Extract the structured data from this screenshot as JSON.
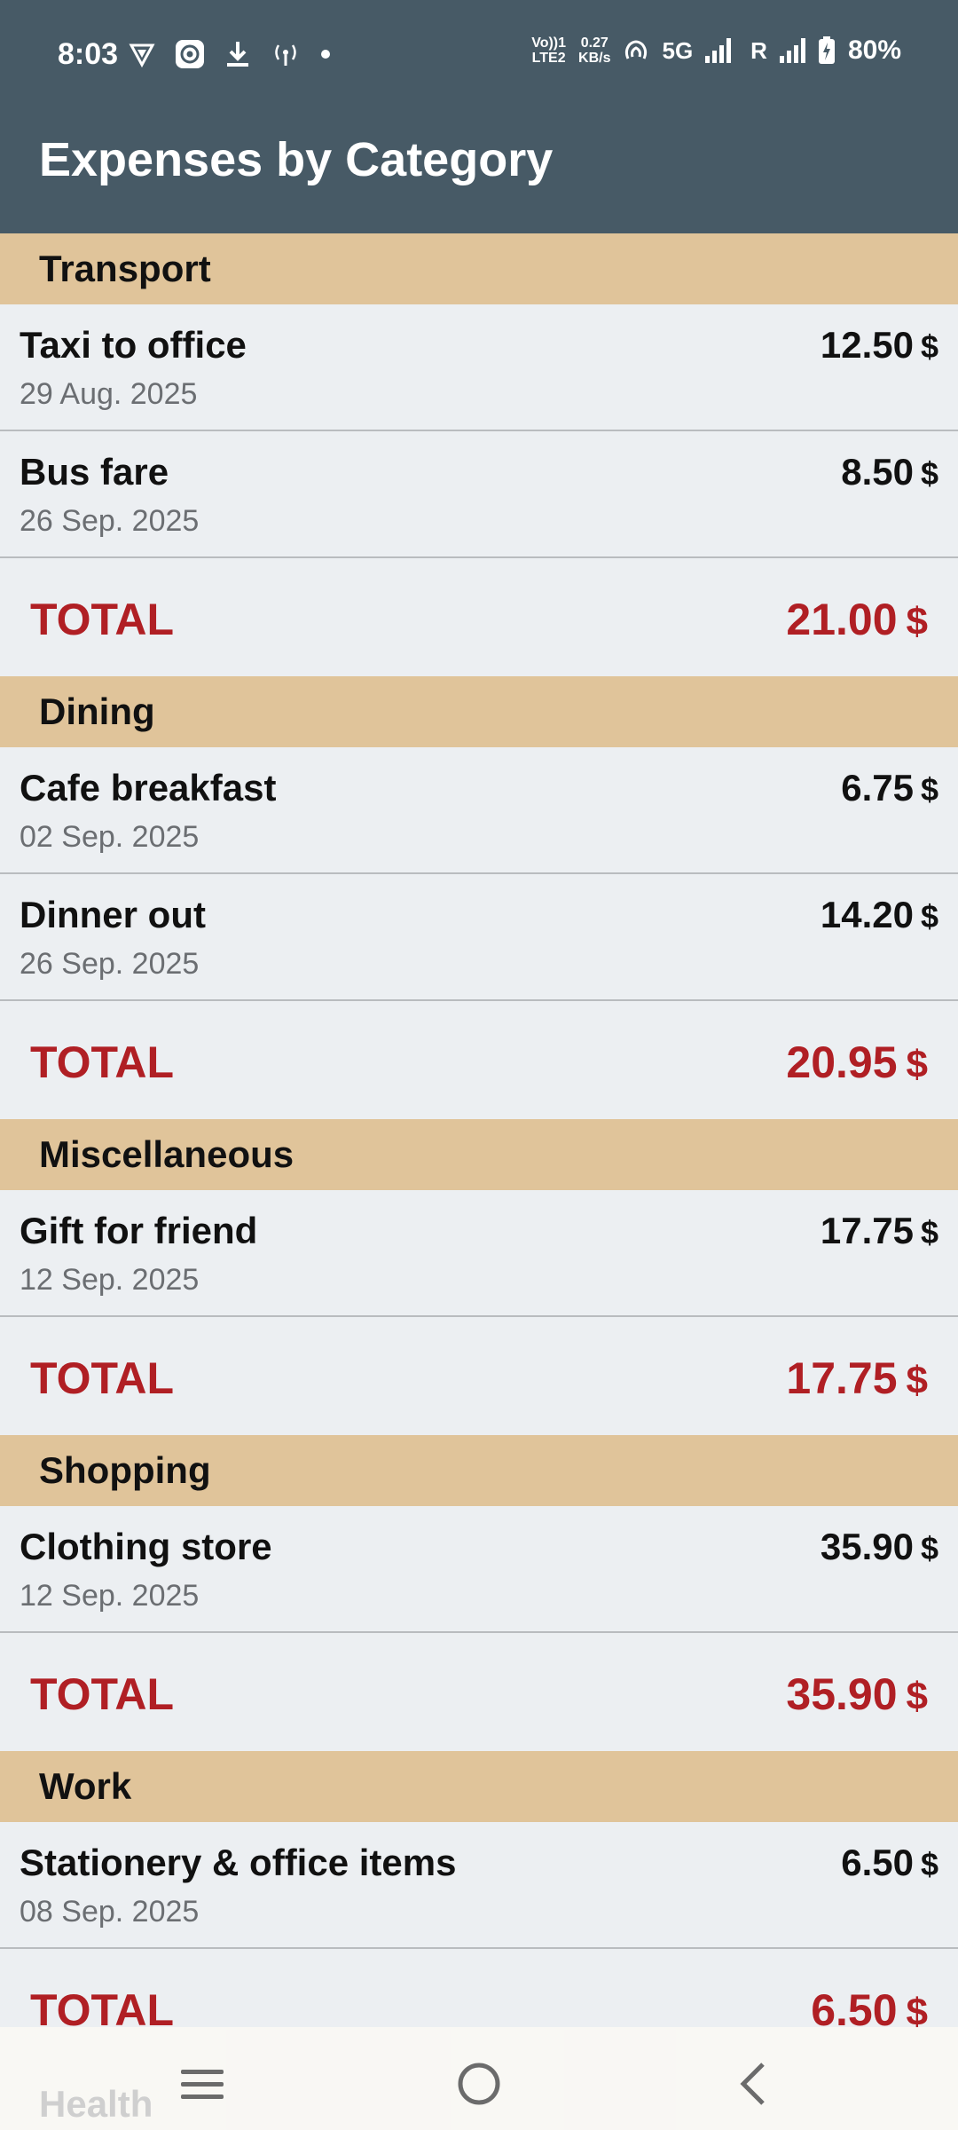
{
  "status_bar": {
    "time": "8:03",
    "speed_value": "0.27",
    "speed_unit": "KB/s",
    "volte_top": "Vo))1",
    "volte_bottom": "LTE2",
    "network": "5G",
    "roaming": "R",
    "battery": "80%"
  },
  "app_bar": {
    "title": "Expenses by Category"
  },
  "categories": [
    {
      "name": "Transport",
      "items": [
        {
          "name": "Taxi to office",
          "date": "29 Aug. 2025",
          "amount": "12.50",
          "currency": "$"
        },
        {
          "name": "Bus fare",
          "date": "26 Sep. 2025",
          "amount": "8.50",
          "currency": "$"
        }
      ],
      "total_label": "TOTAL",
      "total": "21.00",
      "currency": "$"
    },
    {
      "name": "Dining",
      "items": [
        {
          "name": "Cafe breakfast",
          "date": "02 Sep. 2025",
          "amount": "6.75",
          "currency": "$"
        },
        {
          "name": "Dinner out",
          "date": "26 Sep. 2025",
          "amount": "14.20",
          "currency": "$"
        }
      ],
      "total_label": "TOTAL",
      "total": "20.95",
      "currency": "$"
    },
    {
      "name": "Miscellaneous",
      "items": [
        {
          "name": "Gift for friend",
          "date": "12 Sep. 2025",
          "amount": "17.75",
          "currency": "$"
        }
      ],
      "total_label": "TOTAL",
      "total": "17.75",
      "currency": "$"
    },
    {
      "name": "Shopping",
      "items": [
        {
          "name": "Clothing store",
          "date": "12 Sep. 2025",
          "amount": "35.90",
          "currency": "$"
        }
      ],
      "total_label": "TOTAL",
      "total": "35.90",
      "currency": "$"
    },
    {
      "name": "Work",
      "items": [
        {
          "name": "Stationery & office items",
          "date": "08 Sep. 2025",
          "amount": "6.50",
          "currency": "$"
        }
      ],
      "total_label": "TOTAL",
      "total": "6.50",
      "currency": "$"
    }
  ],
  "next_category_partial": "Health",
  "colors": {
    "app_bar": "#475a66",
    "category_header": "#e0c49a",
    "total_text": "#b01f24",
    "list_background": "#eceff2"
  }
}
